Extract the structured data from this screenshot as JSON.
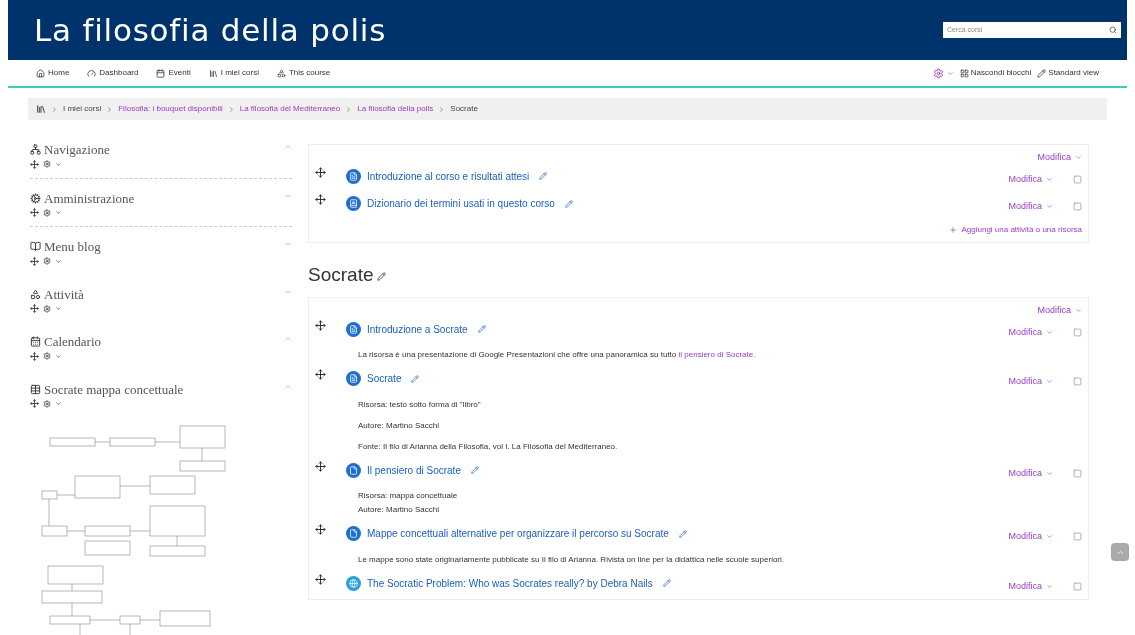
{
  "header": {
    "title": "La filosofia della polis",
    "search": {
      "placeholder": "Cerca corsi"
    }
  },
  "nav": {
    "items": [
      {
        "label": "Home",
        "kind": "home"
      },
      {
        "label": "Dashboard",
        "kind": "dashboard"
      },
      {
        "label": "Eventi",
        "kind": "calendar"
      },
      {
        "label": "I miei corsi",
        "kind": "courses"
      },
      {
        "label": "This course",
        "kind": "course"
      }
    ],
    "right": [
      {
        "label": "Nascondi blocchi",
        "kind": "hide"
      },
      {
        "label": "Standard view",
        "kind": "view"
      }
    ]
  },
  "breadcrumb": [
    {
      "label": "I miei corsi",
      "link": false
    },
    {
      "label": "Filosofia: i bouquet disponibili",
      "link": true
    },
    {
      "label": "La filosofia del Mediterraneo",
      "link": true
    },
    {
      "label": "La filosofia della polis",
      "link": true
    },
    {
      "label": "Socrate",
      "link": false
    }
  ],
  "blocks": [
    {
      "title": "Navigazione",
      "kind": "sitemap"
    },
    {
      "title": "Amministrazione",
      "kind": "cogs"
    },
    {
      "title": "Menu blog",
      "kind": "blog"
    },
    {
      "title": "Attività",
      "kind": "activity"
    },
    {
      "title": "Calendario",
      "kind": "calendar"
    },
    {
      "title": "Socrate mappa concettuale",
      "kind": "map"
    }
  ],
  "sections": [
    {
      "edit": "Modifica",
      "activities": [
        {
          "title": "Introduzione al corso e risultati attesi",
          "kind": "page",
          "edit": "Modifica"
        },
        {
          "title": "Dizionario dei termini usati in questo corso",
          "kind": "glossary",
          "edit": "Modifica"
        }
      ],
      "add": "Aggiungi una attività o una risorsa"
    },
    {
      "title": "Socrate",
      "edit": "Modifica",
      "activities": [
        {
          "title": "Introduzione a Socrate",
          "kind": "page",
          "edit": "Modifica",
          "descriptions": [
            {
              "text": "La risorsa è una presentazione di Google Presentazioni che offre una panoramica su tutto ",
              "link": "il pensiero di Socrate."
            }
          ]
        },
        {
          "title": "Socrate",
          "kind": "page",
          "edit": "Modifica",
          "descriptions": [
            {
              "text": "Risorsa: testo sotto forma di \"libro\""
            },
            {
              "text": "Autore: Martino Sacchi"
            },
            {
              "text": "Fonte: Il filo di Arianna della Filosofia, vol I. La Filosofia del Mediterraneo."
            }
          ]
        },
        {
          "title": "Il pensiero di Socrate",
          "kind": "file",
          "edit": "Modifica",
          "tight": true,
          "descriptions": [
            {
              "text": "Risorsa: mappa concettuale"
            },
            {
              "text": "Autore: Martino Sacchi"
            }
          ]
        },
        {
          "title": "Mappe concettuali alternative per organizzare il percorso su Socrate",
          "kind": "file",
          "edit": "Modifica",
          "descriptions": [
            {
              "text": "Le mappe sono state originariamente pubblicate su Il filo di Arianna. Rivista on line per la didattica nelle scuole superiori."
            }
          ]
        },
        {
          "title": "The Socratic Problem: Who was Socrates really? by Debra Nails",
          "kind": "url",
          "edit": "Modifica"
        }
      ]
    }
  ]
}
